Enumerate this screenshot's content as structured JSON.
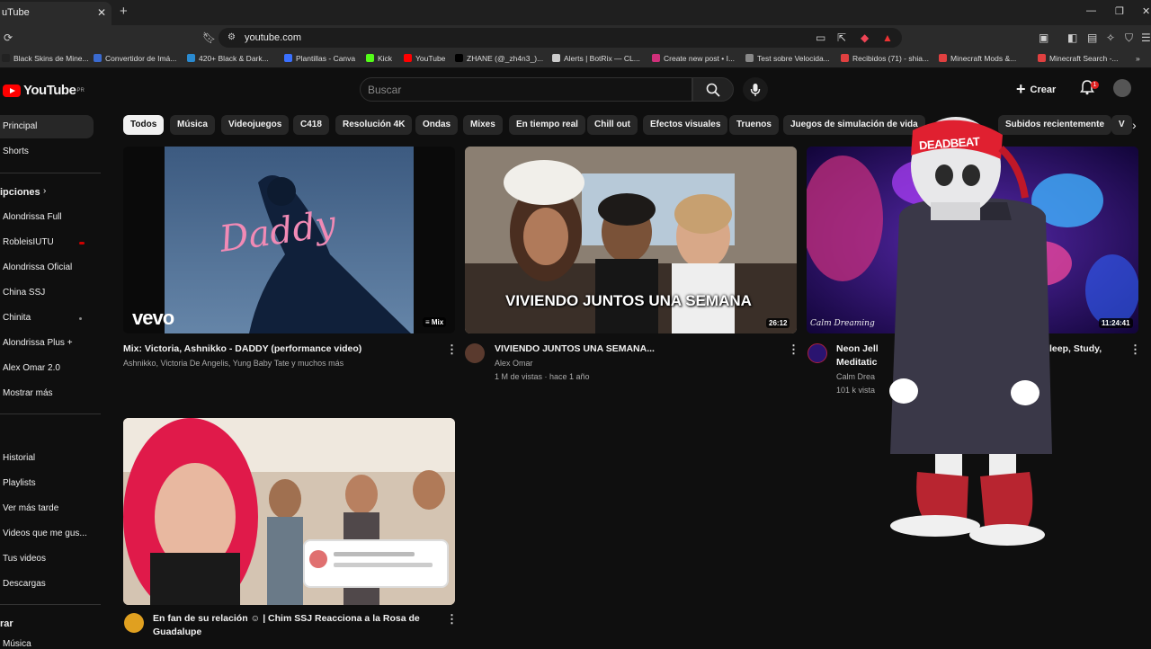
{
  "browser": {
    "tab_title": "uTube",
    "url": "youtube.com",
    "bookmarks": [
      "Black Skins de Mine...",
      "Convertidor de Imá...",
      "420+ Black & Dark...",
      "Plantillas - Canva",
      "Kick",
      "YouTube",
      "ZHANE (@_zh4n3_)...",
      "Alerts | BotRix — CL...",
      "Create new post • I...",
      "Test sobre Velocida...",
      "Recibidos (71) - shia...",
      "Minecraft Mods &...",
      "Minecraft Search -..."
    ]
  },
  "header": {
    "logo": "YouTube",
    "logo_region": "PR",
    "search_placeholder": "Buscar",
    "create_label": "Crear",
    "notification_count": "1"
  },
  "sidebar": {
    "top": [
      "Principal",
      "Shorts"
    ],
    "subs_heading": "ipciones",
    "subs": [
      "Alondrissa Full",
      "RobleisIUTU",
      "Alondrissa Oficial",
      "China SSJ",
      "Chinita",
      "Alondrissa Plus +",
      "Alex Omar 2.0",
      "Mostrar más"
    ],
    "you": [
      "Historial",
      "Playlists",
      "Ver más tarde",
      "Videos que me gus...",
      "Tus videos",
      "Descargas"
    ],
    "explore_heading": "rar",
    "explore": [
      "Música"
    ]
  },
  "chips": [
    "Todos",
    "Música",
    "Videojuegos",
    "C418",
    "Resolución 4K",
    "Ondas",
    "Mixes",
    "En tiempo real",
    "Chill out",
    "Efectos visuales",
    "Truenos",
    "Juegos de simulación de vida",
    "Subidos recientemente",
    "V"
  ],
  "videos": [
    {
      "title": "Mix: Victoria, Ashnikko - DADDY (performance video)",
      "meta": "Ashnikko, Victoria De Angelis, Yung Baby Tate y muchos más",
      "thumb_text": "Daddy",
      "brand": "vevo",
      "duration": "Mix"
    },
    {
      "title": "VIVIENDO JUNTOS UNA SEMANA...",
      "channel": "Alex Omar",
      "meta": "1 M de vistas · hace 1 año",
      "thumb_text": "VIVIENDO JUNTOS UNA SEMANA",
      "duration": "26:12"
    },
    {
      "title_a": "Neon Jell",
      "title_b": "Meditatic",
      "title_c": "leep, Study,",
      "channel": "Calm Drea",
      "meta": "101 k vista",
      "thumb_brand": "Calm Dreaming",
      "duration": "11:24:41"
    },
    {
      "title_a": "En fan de su relación",
      "title_b": "| Chim SSJ Reacciona a la Rosa de",
      "title_c": "Guadalupe"
    }
  ],
  "overlay": {
    "hat_text": "DEADBEAT"
  },
  "colors": {
    "background": "#0f0f0f",
    "chip": "#272727",
    "chip_selected": "#f1f1f1",
    "brand": "#ff0000"
  }
}
